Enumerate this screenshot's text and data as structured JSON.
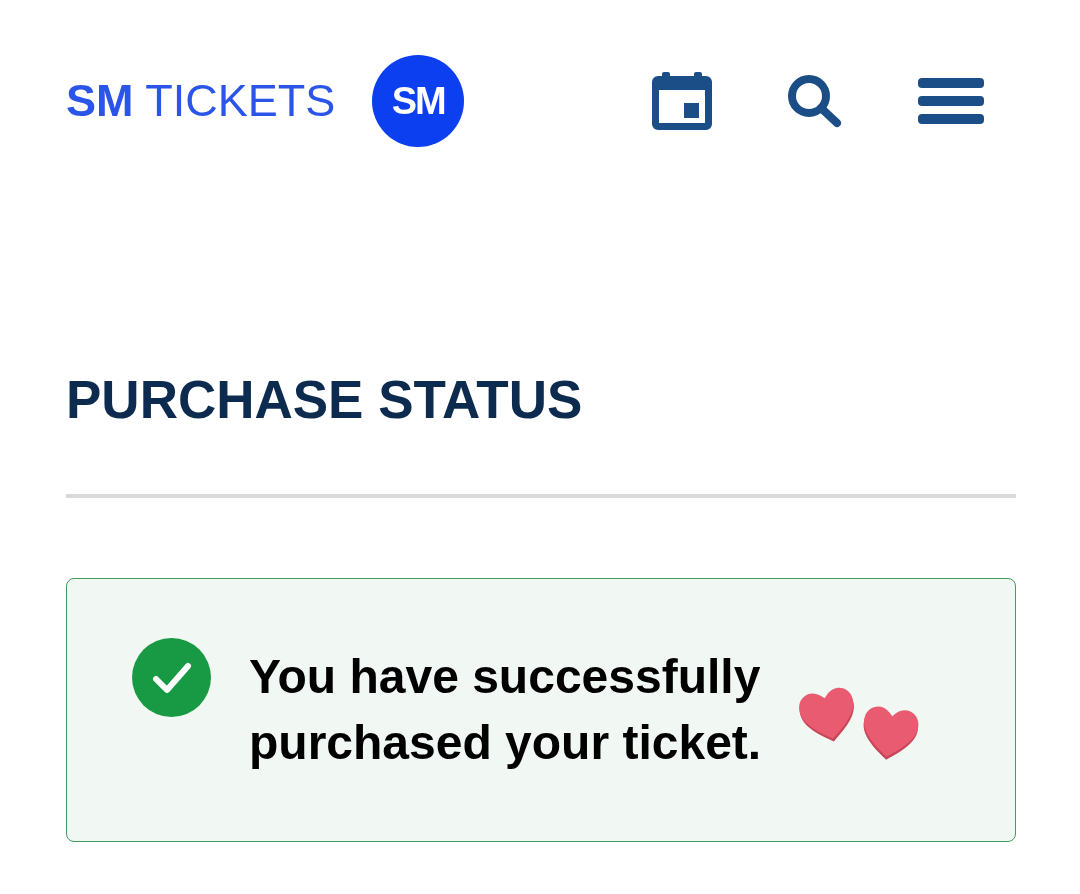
{
  "header": {
    "brand_name": "**SM** TICKETS",
    "badge_text": "SM"
  },
  "page": {
    "title": "PURCHASE STATUS"
  },
  "alert": {
    "kind": "success",
    "message": "You have successfully purchased your ticket."
  }
}
